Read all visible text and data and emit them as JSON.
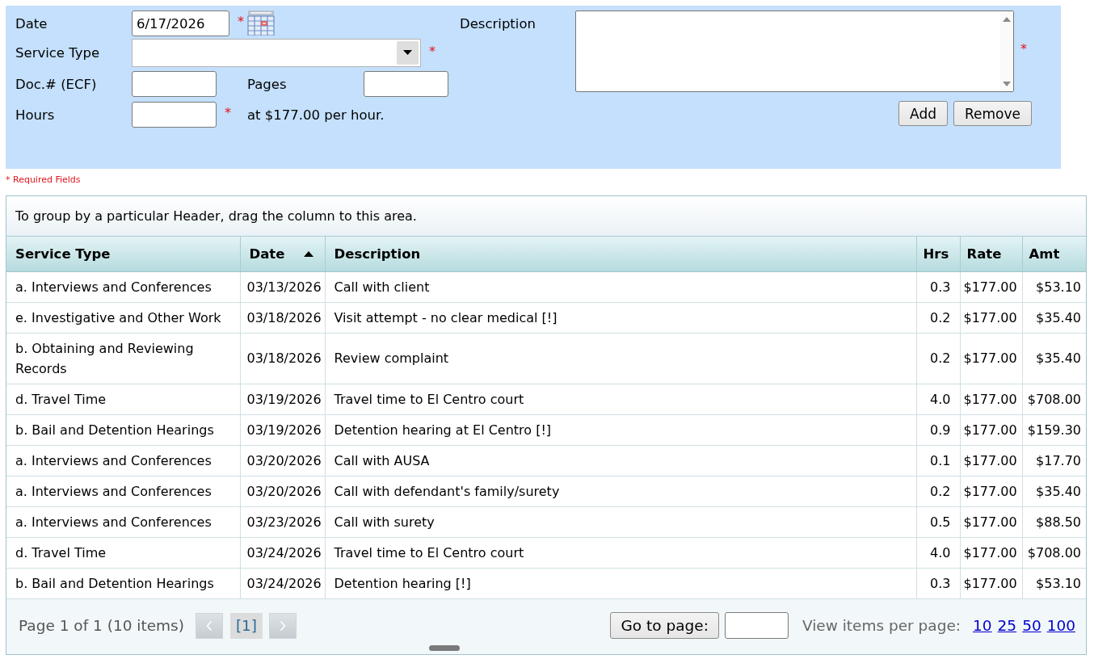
{
  "form": {
    "date": {
      "label": "Date",
      "value": "6/17/2026",
      "required_mark": "*"
    },
    "service_type": {
      "label": "Service Type",
      "required_mark": "*"
    },
    "doc_number": {
      "label": "Doc.# (ECF)"
    },
    "pages": {
      "label": "Pages"
    },
    "hours": {
      "label": "Hours",
      "required_mark": "*",
      "rate_note": "at $177.00 per hour."
    },
    "description": {
      "label": "Description",
      "required_mark": "*"
    },
    "buttons": [
      "Add",
      "Remove"
    ]
  },
  "required_note": "* Required Fields",
  "grid": {
    "group_hint": "To group by a particular Header, drag the column to this area.",
    "columns": [
      {
        "label": "Service Type",
        "kind": "text"
      },
      {
        "label": "Date",
        "kind": "text",
        "sorted": true,
        "ascending": true
      },
      {
        "label": "Description",
        "kind": "text"
      },
      {
        "label": "Hrs",
        "kind": "numeric"
      },
      {
        "label": "Rate",
        "kind": "numeric"
      },
      {
        "label": "Amt",
        "kind": "numeric"
      }
    ],
    "rows": [
      [
        "a. Interviews and Conferences",
        "03/13/2026",
        "Call with client",
        "0.3",
        "$177.00",
        "$53.10"
      ],
      [
        "e. Investigative and Other Work",
        "03/18/2026",
        "Visit attempt - no clear medical [!]",
        "0.2",
        "$177.00",
        "$35.40"
      ],
      [
        "b. Obtaining and Reviewing Records",
        "03/18/2026",
        "Review complaint",
        "0.2",
        "$177.00",
        "$35.40"
      ],
      [
        "d. Travel Time",
        "03/19/2026",
        "Travel time to El Centro court",
        "4.0",
        "$177.00",
        "$708.00"
      ],
      [
        "b. Bail and Detention Hearings",
        "03/19/2026",
        "Detention hearing at El Centro [!]",
        "0.9",
        "$177.00",
        "$159.30"
      ],
      [
        "a. Interviews and Conferences",
        "03/20/2026",
        "Call with AUSA",
        "0.1",
        "$177.00",
        "$17.70"
      ],
      [
        "a. Interviews and Conferences",
        "03/20/2026",
        "Call with defendant's family/surety",
        "0.2",
        "$177.00",
        "$35.40"
      ],
      [
        "a. Interviews and Conferences",
        "03/23/2026",
        "Call with surety",
        "0.5",
        "$177.00",
        "$88.50"
      ],
      [
        "d. Travel Time",
        "03/24/2026",
        "Travel time to El Centro court",
        "4.0",
        "$177.00",
        "$708.00"
      ],
      [
        "b. Bail and Detention Hearings",
        "03/24/2026",
        "Detention hearing [!]",
        "0.3",
        "$177.00",
        "$53.10"
      ]
    ],
    "pager": {
      "summary": "Page 1 of 1 (10 items)",
      "prev": {
        "disabled": true
      },
      "next": {
        "disabled": true
      },
      "pages": [
        {
          "label": "[1]",
          "selected": true
        }
      ],
      "goto_label": "Go to page:",
      "page_size_label": "View items per page:",
      "page_sizes": [
        "10",
        "25",
        "50",
        "100"
      ]
    }
  }
}
